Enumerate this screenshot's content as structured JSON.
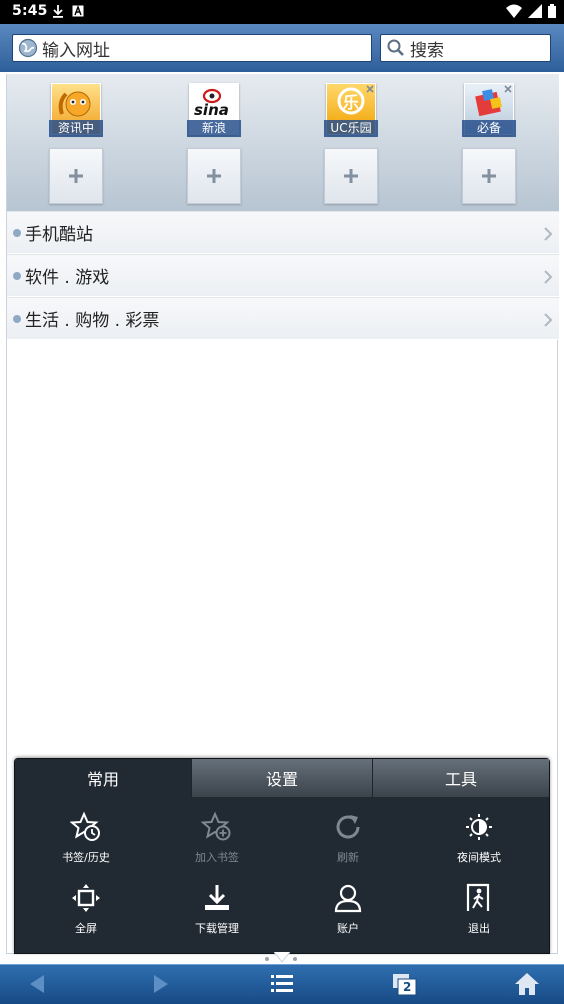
{
  "status_bar": {
    "time": "5:45"
  },
  "address_bar": {
    "url_placeholder": "输入网址",
    "search_placeholder": "搜索"
  },
  "speed_dial": {
    "tiles": [
      {
        "label": "资讯中",
        "icon": "uc-squirrel-icon"
      },
      {
        "label": "新浪",
        "icon": "sina-logo-icon"
      },
      {
        "label": "UC乐园",
        "icon": "uc-paradise-icon"
      },
      {
        "label": "必备",
        "icon": "essentials-box-icon"
      }
    ],
    "add_label": "+"
  },
  "categories": [
    {
      "label": "手机酷站"
    },
    {
      "label": "软件 . 游戏"
    },
    {
      "label": "生活 . 购物 . 彩票"
    }
  ],
  "menu": {
    "tabs": [
      {
        "label": "常用",
        "active": true
      },
      {
        "label": "设置",
        "active": false
      },
      {
        "label": "工具",
        "active": false
      }
    ],
    "items": [
      {
        "label": "书签/历史",
        "icon": "bookmark-history-icon",
        "enabled": true
      },
      {
        "label": "加入书签",
        "icon": "add-bookmark-icon",
        "enabled": false
      },
      {
        "label": "刷新",
        "icon": "refresh-icon",
        "enabled": false
      },
      {
        "label": "夜间模式",
        "icon": "night-mode-icon",
        "enabled": true
      },
      {
        "label": "全屏",
        "icon": "fullscreen-icon",
        "enabled": true
      },
      {
        "label": "下载管理",
        "icon": "download-icon",
        "enabled": true
      },
      {
        "label": "账户",
        "icon": "account-icon",
        "enabled": true
      },
      {
        "label": "退出",
        "icon": "exit-icon",
        "enabled": true
      }
    ]
  },
  "bottom_bar": {
    "tab_count": "2"
  },
  "colors": {
    "accent": "#2f6fb0",
    "menu_bg": "#212a33",
    "disabled": "#7f8891"
  }
}
